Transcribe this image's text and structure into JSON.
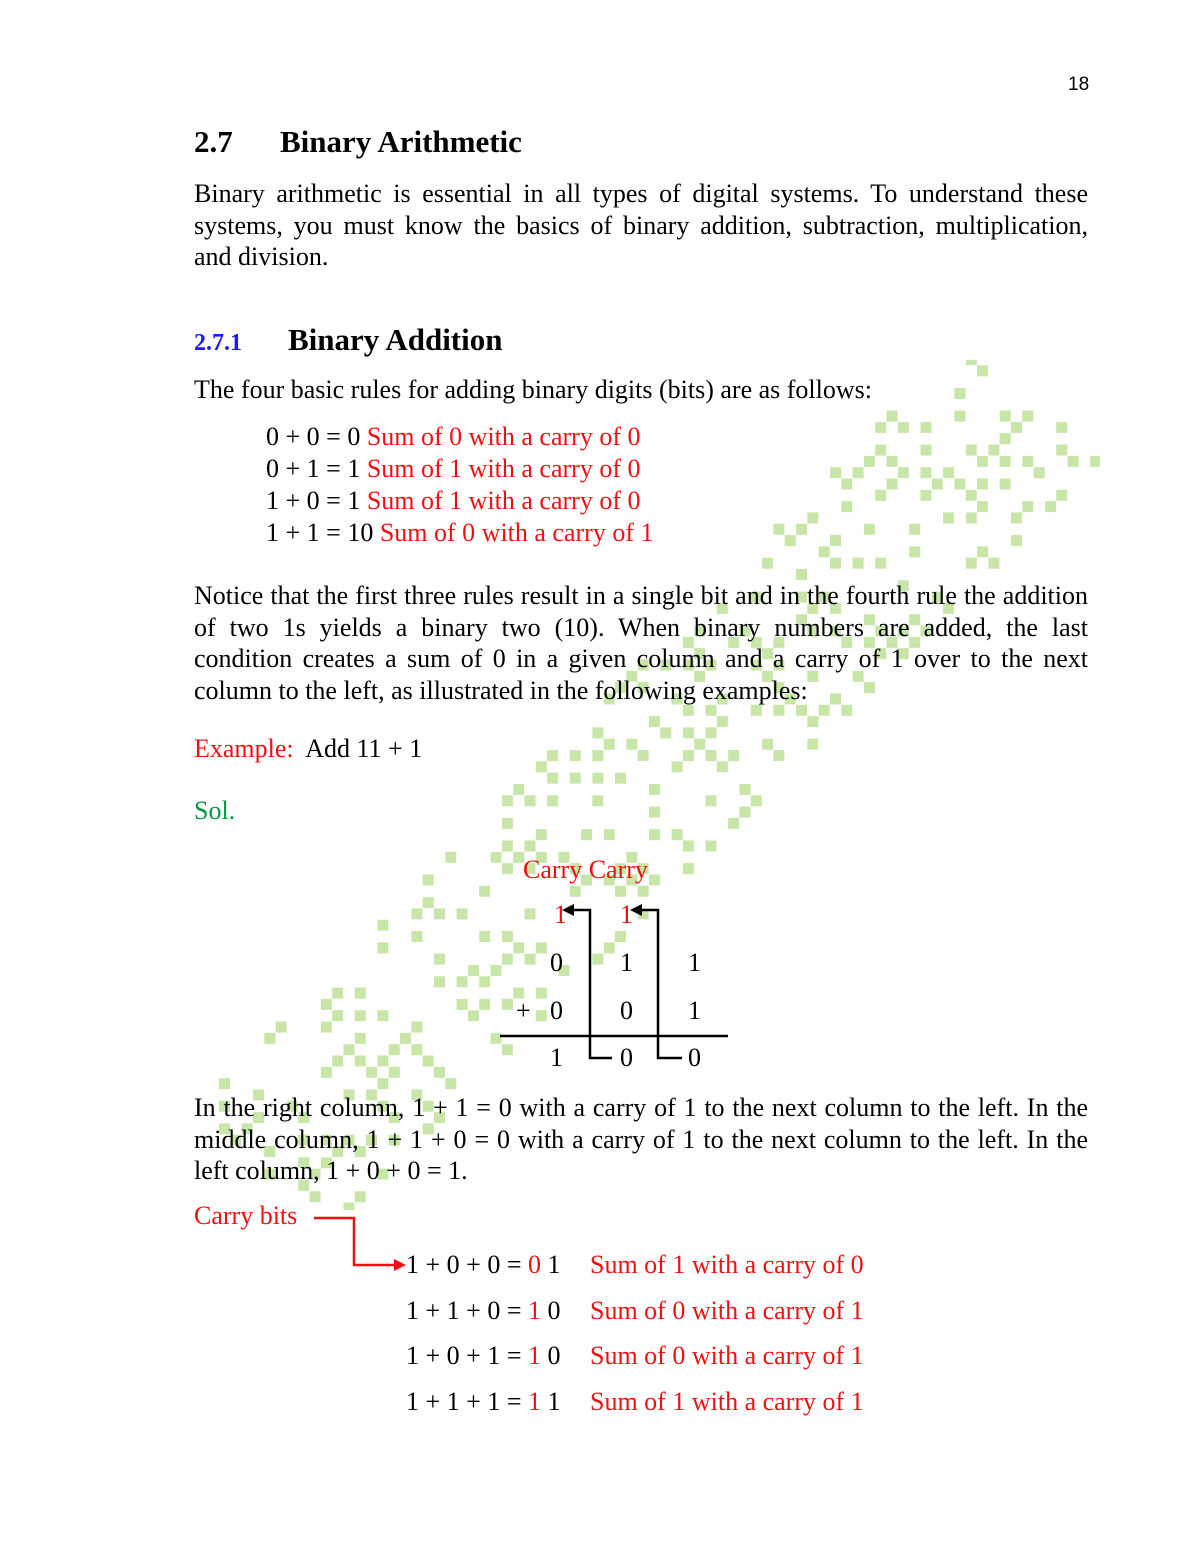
{
  "page_number": "18",
  "section": {
    "number": "2.7",
    "title": "Binary Arithmetic"
  },
  "intro": "Binary arithmetic is essential in all types of digital systems. To understand these systems, you must know the basics of binary addition, subtraction, multiplication, and division.",
  "subsection": {
    "number": "2.7.1",
    "title": "Binary Addition"
  },
  "rules_intro": "The four basic rules for adding binary digits (bits) are as follows:",
  "rules": [
    {
      "expr": "0 + 0 = 0",
      "note": "Sum of 0 with a carry of 0"
    },
    {
      "expr": "0 + 1 = 1",
      "note": "Sum of 1 with a carry of 0"
    },
    {
      "expr": "1 + 0 = 1",
      "note": "Sum of 1 with a carry of 0"
    },
    {
      "expr": "1 + 1 = 10",
      "note": "Sum of 0 with a carry of 1"
    }
  ],
  "notice": "Notice that the first three rules result in a single bit and in the fourth rule the addition of two 1s yields a binary two (10). When binary numbers are added, the last condition creates a sum of 0 in a given column and a carry of 1 over to the next column to the left, as illustrated in the following examples:",
  "example": {
    "label": "Example:",
    "text": "Add 11 + 1"
  },
  "solution_label": "Sol.",
  "diagram": {
    "carry_header": "Carry Carry",
    "carry_bits": [
      "1",
      "1"
    ],
    "row1": [
      "0",
      "1",
      "1"
    ],
    "plus": "+",
    "row2": [
      "0",
      "0",
      "1"
    ],
    "result": [
      "1",
      "0",
      "0"
    ]
  },
  "explanation": "In the right column, 1 + 1 = 0 with a carry of 1 to the next column to the left. In the middle column, 1 + 1 + 0 = 0 with a carry of 1 to the next column to the left. In the left column, 1 + 0 + 0 = 1.",
  "carry_bits_label": "Carry bits",
  "carry_rules": [
    {
      "expr": "1 + 0 + 0 =",
      "carry": "0",
      "sum": "1",
      "note": "Sum of 1 with a carry of 0"
    },
    {
      "expr": "1 + 1 + 0 =",
      "carry": "1",
      "sum": "0",
      "note": "Sum of 0 with a carry of 1"
    },
    {
      "expr": "1 + 0 + 1 =",
      "carry": "1",
      "sum": "0",
      "note": "Sum of 0 with a carry of 1"
    },
    {
      "expr": "1 + 1 + 1 =",
      "carry": "1",
      "sum": "1",
      "note": "Sum of 1 with a carry of 1"
    }
  ],
  "colors": {
    "accent_red": "#ee1111",
    "heading_blue": "#1a1aff",
    "sol_green": "#009944",
    "watermark_green": "#c8e6a8"
  }
}
